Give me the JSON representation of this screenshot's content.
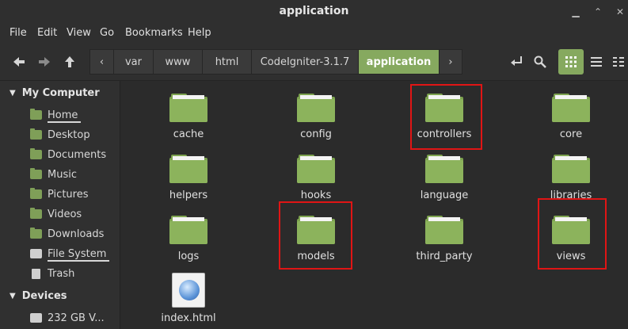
{
  "window": {
    "title": "application"
  },
  "menu": [
    "File",
    "Edit",
    "View",
    "Go",
    "Bookmarks",
    "Help"
  ],
  "breadcrumbs": [
    "var",
    "www",
    "html",
    "CodeIgniter-3.1.7",
    "application"
  ],
  "sidebar": {
    "sections": [
      {
        "title": "My Computer",
        "items": [
          "Home",
          "Desktop",
          "Documents",
          "Music",
          "Pictures",
          "Videos",
          "Downloads",
          "File System",
          "Trash"
        ]
      },
      {
        "title": "Devices",
        "items": [
          "232 GB V..."
        ]
      }
    ]
  },
  "files": [
    "cache",
    "config",
    "controllers",
    "core",
    "helpers",
    "hooks",
    "language",
    "libraries",
    "logs",
    "models",
    "third_party",
    "views",
    "index.html"
  ],
  "highlighted": [
    "controllers",
    "models",
    "views"
  ],
  "colors": {
    "accent": "#86a95f",
    "folder": "#8cb35c",
    "highlight": "#e01515"
  }
}
